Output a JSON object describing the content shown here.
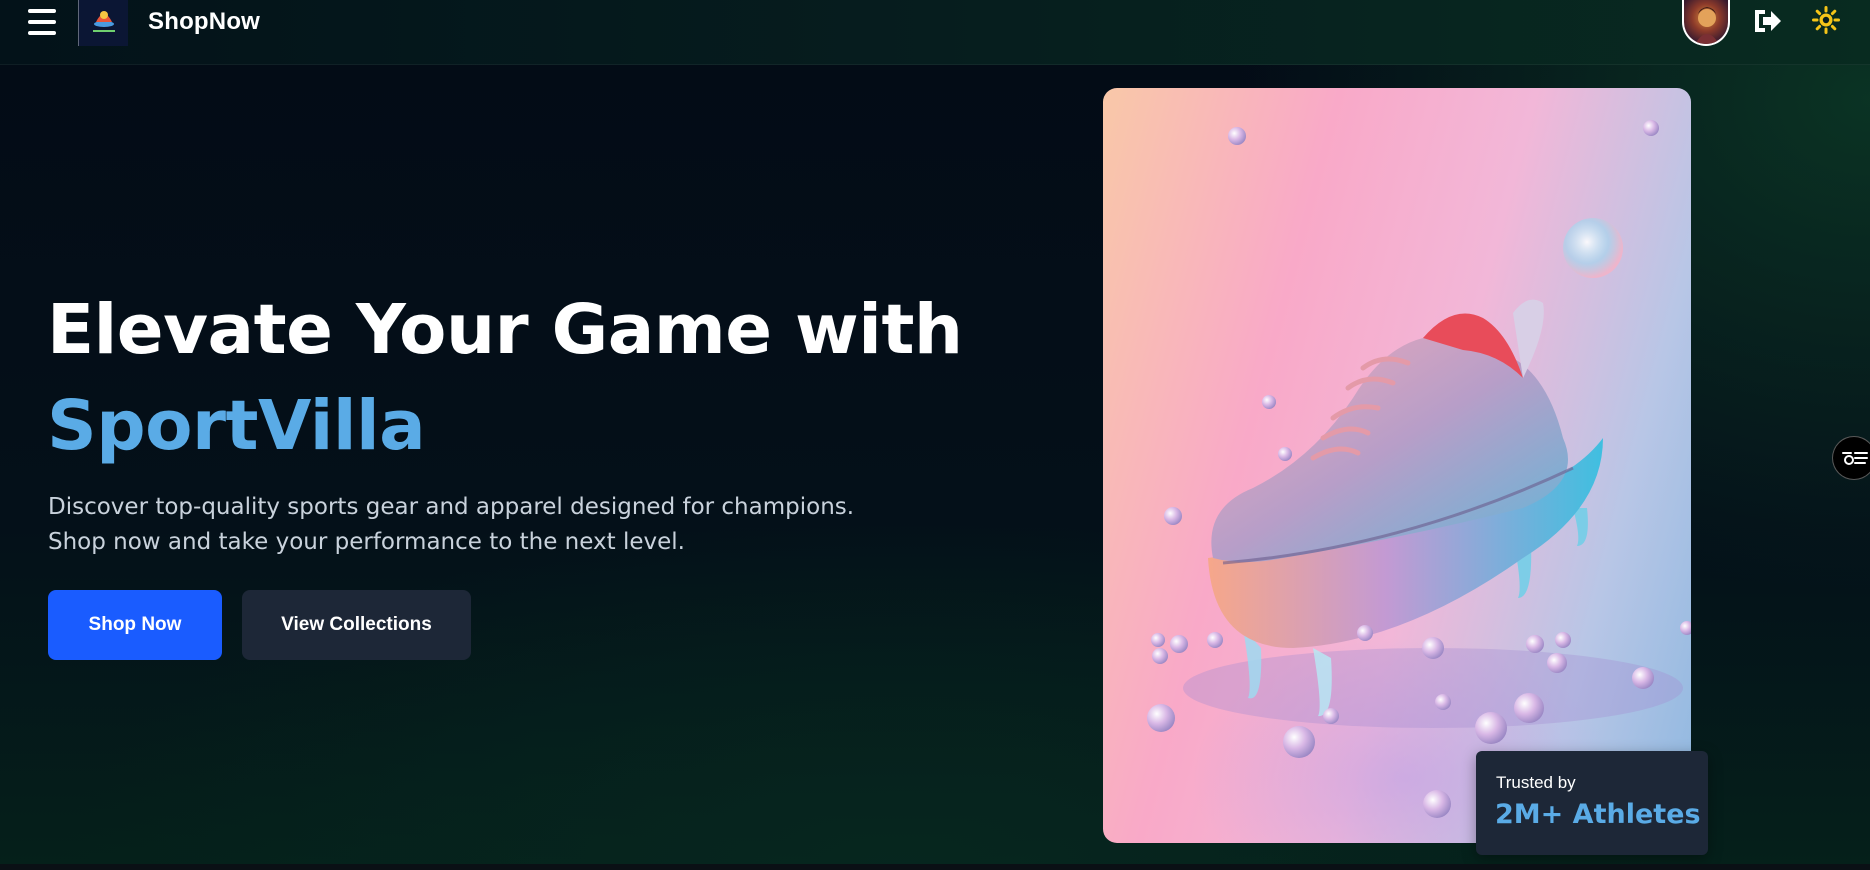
{
  "header": {
    "brand": "ShopNow",
    "menu_icon": "hamburger-menu-icon",
    "logo_icon": "shopnow-logo-icon",
    "avatar_icon": "user-avatar",
    "logout_icon": "logout-icon",
    "theme_icon": "sun-icon"
  },
  "hero": {
    "title_line1": "Elevate Your Game with",
    "title_highlight": "SportVilla",
    "description": "Discover top-quality sports gear and apparel designed for champions. Shop now and take your performance to the next level.",
    "primary_button": "Shop Now",
    "secondary_button": "View Collections",
    "image_subject": "sneaker-product-image"
  },
  "trust_badge": {
    "label": "Trusted by",
    "value": "2M+ Athletes"
  },
  "side_panel_toggle_icon": "filter-toggle-icon",
  "colors": {
    "accent": "#5aabe6",
    "primary_button": "#1a5cff",
    "secondary_button": "#1d2737",
    "badge_background": "#1d2737",
    "theme_icon": "#f5c518"
  }
}
